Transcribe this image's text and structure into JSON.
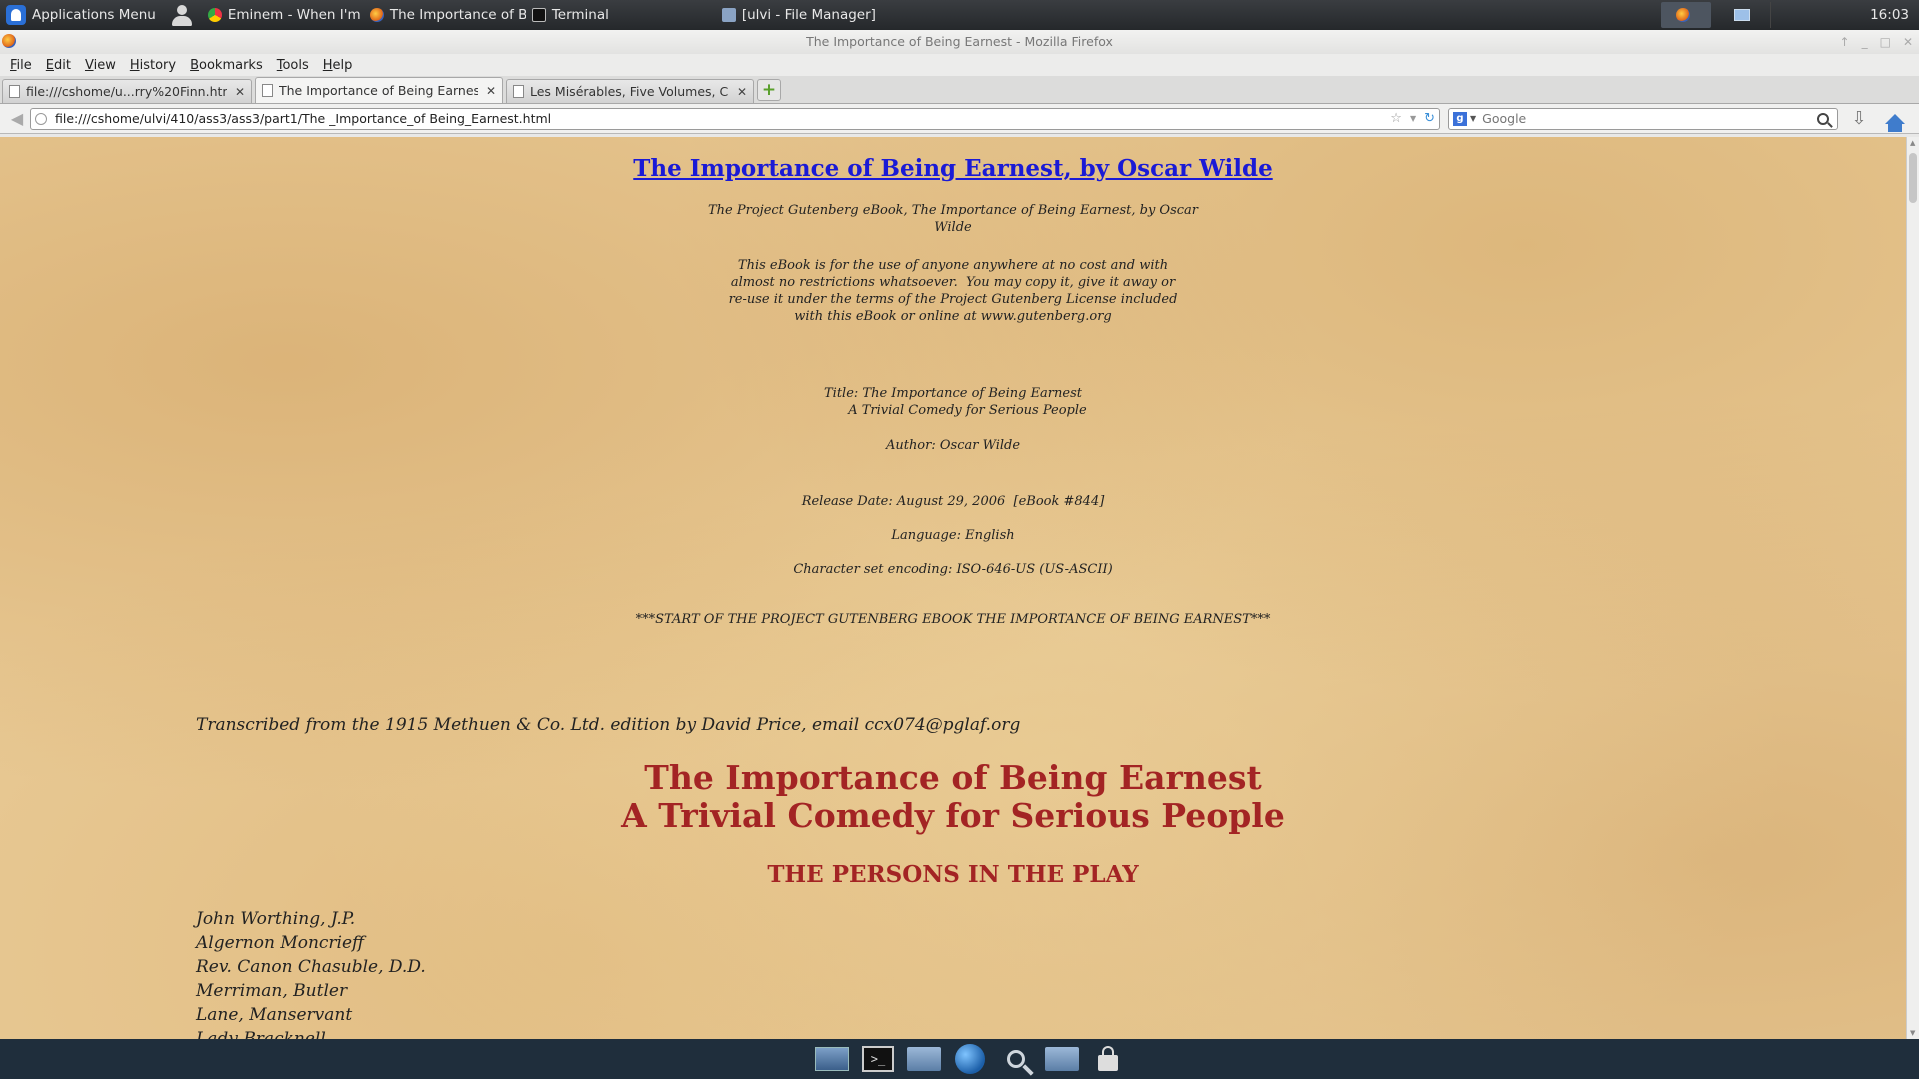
{
  "panel": {
    "app_menu": "Applications Menu",
    "tasks": [
      {
        "label": "Eminem - When I'm Gone -...",
        "icon": "chrome-icon"
      },
      {
        "label": "The Importance of Being E...",
        "icon": "firefox-icon"
      },
      {
        "label": "Terminal",
        "icon": "terminal-icon"
      },
      {
        "label": "[ulvi - File Manager]",
        "icon": "file-manager-icon"
      }
    ],
    "clock": "16:03"
  },
  "window": {
    "title": "The Importance of Being Earnest - Mozilla Firefox"
  },
  "menu": [
    "File",
    "Edit",
    "View",
    "History",
    "Bookmarks",
    "Tools",
    "Help"
  ],
  "tabs": [
    {
      "label": "file:///cshome/u...rry%20Finn.html",
      "selected": false
    },
    {
      "label": "The Importance of Being Earnest",
      "selected": true
    },
    {
      "label": "Les Misérables, Five Volumes, C...",
      "selected": false
    }
  ],
  "navbar": {
    "url": "file:///cshome/ulvi/410/ass3/ass3/part1/The _Importance_of Being_Earnest.html",
    "search_placeholder": "Google",
    "search_engine": "g"
  },
  "page": {
    "doc_title": "The Importance of Being Earnest, by Oscar Wilde",
    "ebook_line": "The Project Gutenberg eBook, The Importance of Being Earnest, by Oscar\nWilde",
    "license": "This eBook is for the use of anyone anywhere at no cost and with\nalmost no restrictions whatsoever.  You may copy it, give it away or\nre-use it under the terms of the Project Gutenberg License included\nwith this eBook or online at www.gutenberg.org",
    "title_line": "Title: The Importance of Being Earnest\n       A Trivial Comedy for Serious People",
    "author": "Author: Oscar Wilde",
    "release_date": "Release Date: August 29, 2006  [eBook #844]",
    "language": "Language: English",
    "charset": "Character set encoding: ISO-646-US (US-ASCII)",
    "start_marker": "***START OF THE PROJECT GUTENBERG EBOOK THE IMPORTANCE OF BEING EARNEST***",
    "transcribed": "Transcribed from the 1915 Methuen & Co. Ltd. edition by David Price, email ccx074@pglaf.org",
    "main_title_1": "The Importance of Being Earnest",
    "main_title_2": "A Trivial Comedy for Serious People",
    "persons_heading": "THE PERSONS IN THE PLAY",
    "cast": [
      "John Worthing, J.P.",
      "Algernon Moncrieff",
      "Rev. Canon Chasuble, D.D.",
      "Merriman, Butler",
      "Lane, Manservant",
      "Lady Bracknell"
    ]
  },
  "colors": {
    "link": "#1a1ad6",
    "heading_red": "#a32424",
    "parchment": "#e8c994"
  }
}
